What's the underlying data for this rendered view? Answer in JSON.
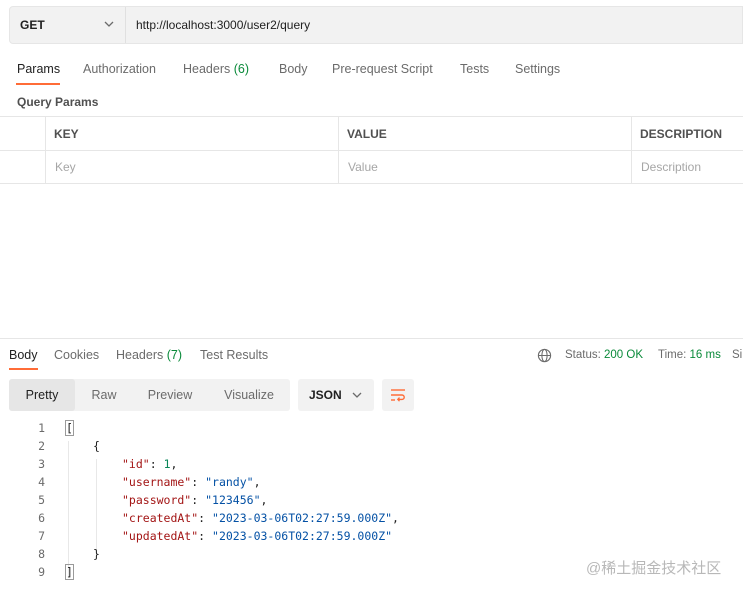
{
  "request": {
    "method": "GET",
    "url": "http://localhost:3000/user2/query"
  },
  "request_tabs": {
    "params": "Params",
    "authorization": "Authorization",
    "headers_label": "Headers",
    "headers_count": "(6)",
    "body": "Body",
    "prerequest": "Pre-request Script",
    "tests": "Tests",
    "settings": "Settings"
  },
  "query_params": {
    "title": "Query Params",
    "columns": [
      "KEY",
      "VALUE",
      "DESCRIPTION"
    ],
    "placeholders": [
      "Key",
      "Value",
      "Description"
    ]
  },
  "response_tabs": {
    "body": "Body",
    "cookies": "Cookies",
    "headers_label": "Headers",
    "headers_count": "(7)",
    "test_results": "Test Results"
  },
  "status": {
    "status_label": "Status:",
    "status_value": "200 OK",
    "time_label": "Time:",
    "time_value": "16 ms",
    "size_label": "Si"
  },
  "view_modes": [
    "Pretty",
    "Raw",
    "Preview",
    "Visualize"
  ],
  "format": "JSON",
  "code_lines": [
    {
      "num": "1",
      "text": "["
    },
    {
      "num": "2",
      "text": "{"
    },
    {
      "num": "3",
      "key": "\"id\"",
      "value": "1",
      "type": "number",
      "trail": ","
    },
    {
      "num": "4",
      "key": "\"username\"",
      "value": "\"randy\"",
      "type": "string",
      "trail": ","
    },
    {
      "num": "5",
      "key": "\"password\"",
      "value": "\"123456\"",
      "type": "string",
      "trail": ","
    },
    {
      "num": "6",
      "key": "\"createdAt\"",
      "value": "\"2023-03-06T02:27:59.000Z\"",
      "type": "string",
      "trail": ","
    },
    {
      "num": "7",
      "key": "\"updatedAt\"",
      "value": "\"2023-03-06T02:27:59.000Z\"",
      "type": "string",
      "trail": ""
    },
    {
      "num": "8",
      "text": "}"
    },
    {
      "num": "9",
      "text": "]"
    }
  ],
  "watermark": "@稀土掘金技术社区"
}
